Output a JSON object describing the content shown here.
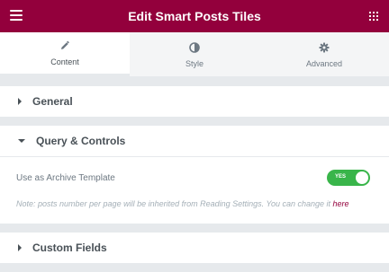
{
  "header": {
    "title": "Edit Smart Posts Tiles",
    "menu_icon": "hamburger-icon",
    "apps_icon": "grid-icon",
    "bg_color": "#93003c"
  },
  "tabs": [
    {
      "label": "Content",
      "icon": "pencil-icon",
      "active": true
    },
    {
      "label": "Style",
      "icon": "half-circle-icon",
      "active": false
    },
    {
      "label": "Advanced",
      "icon": "gear-icon",
      "active": false
    }
  ],
  "sections": {
    "general": {
      "title": "General",
      "expanded": false
    },
    "query_controls": {
      "title": "Query & Controls",
      "expanded": true,
      "archive_label": "Use as Archive Template",
      "toggle_text": "YES",
      "toggle_on": true,
      "note_text": "Note: posts number per page will be inherited from Reading Settings. You can change it ",
      "note_link": "here"
    },
    "custom_fields": {
      "title": "Custom Fields",
      "expanded": false
    }
  },
  "colors": {
    "accent": "#93003c",
    "toggle_on": "#39b54a"
  }
}
